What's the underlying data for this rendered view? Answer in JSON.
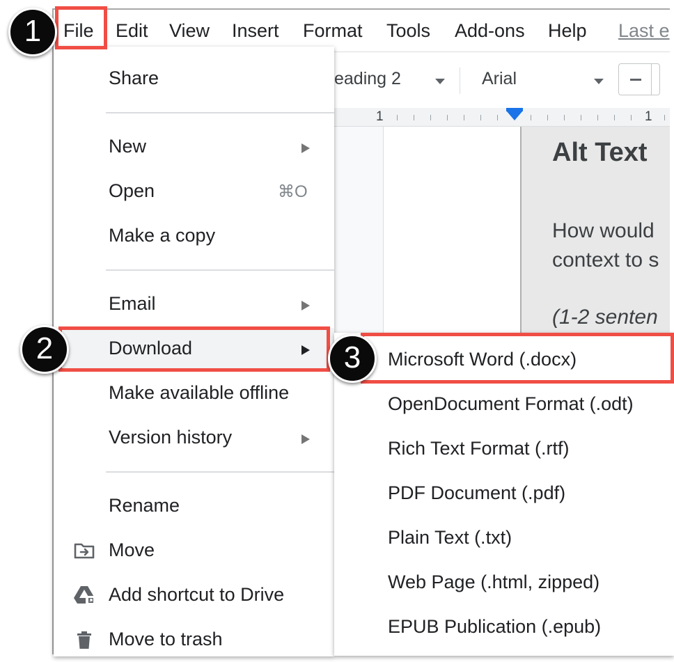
{
  "menubar": {
    "items": [
      "File",
      "Edit",
      "View",
      "Insert",
      "Format",
      "Tools",
      "Add-ons",
      "Help"
    ],
    "last_edit": "Last e"
  },
  "toolbar": {
    "style": "eading 2",
    "font": "Arial"
  },
  "ruler": {
    "left_number": "1",
    "right_number": "1"
  },
  "document": {
    "heading": "Alt Text",
    "line1": "How would",
    "line2": "context to s",
    "line3": "(1-2 senten"
  },
  "file_menu": {
    "share": "Share",
    "new": "New",
    "open": "Open",
    "open_shortcut": "⌘O",
    "make_copy": "Make a copy",
    "email": "Email",
    "download": "Download",
    "offline": "Make available offline",
    "version_history": "Version history",
    "rename": "Rename",
    "move": "Move",
    "add_shortcut": "Add shortcut to Drive",
    "trash": "Move to trash"
  },
  "download_submenu": {
    "items": [
      "Microsoft Word (.docx)",
      "OpenDocument Format (.odt)",
      "Rich Text Format (.rtf)",
      "PDF Document (.pdf)",
      "Plain Text (.txt)",
      "Web Page (.html, zipped)",
      "EPUB Publication (.epub)"
    ]
  },
  "steps": [
    "1",
    "2",
    "3"
  ],
  "colors": {
    "highlight_red": "#f04e45",
    "badge_black": "#0a0a0a",
    "ruler_marker": "#1a73e8"
  }
}
